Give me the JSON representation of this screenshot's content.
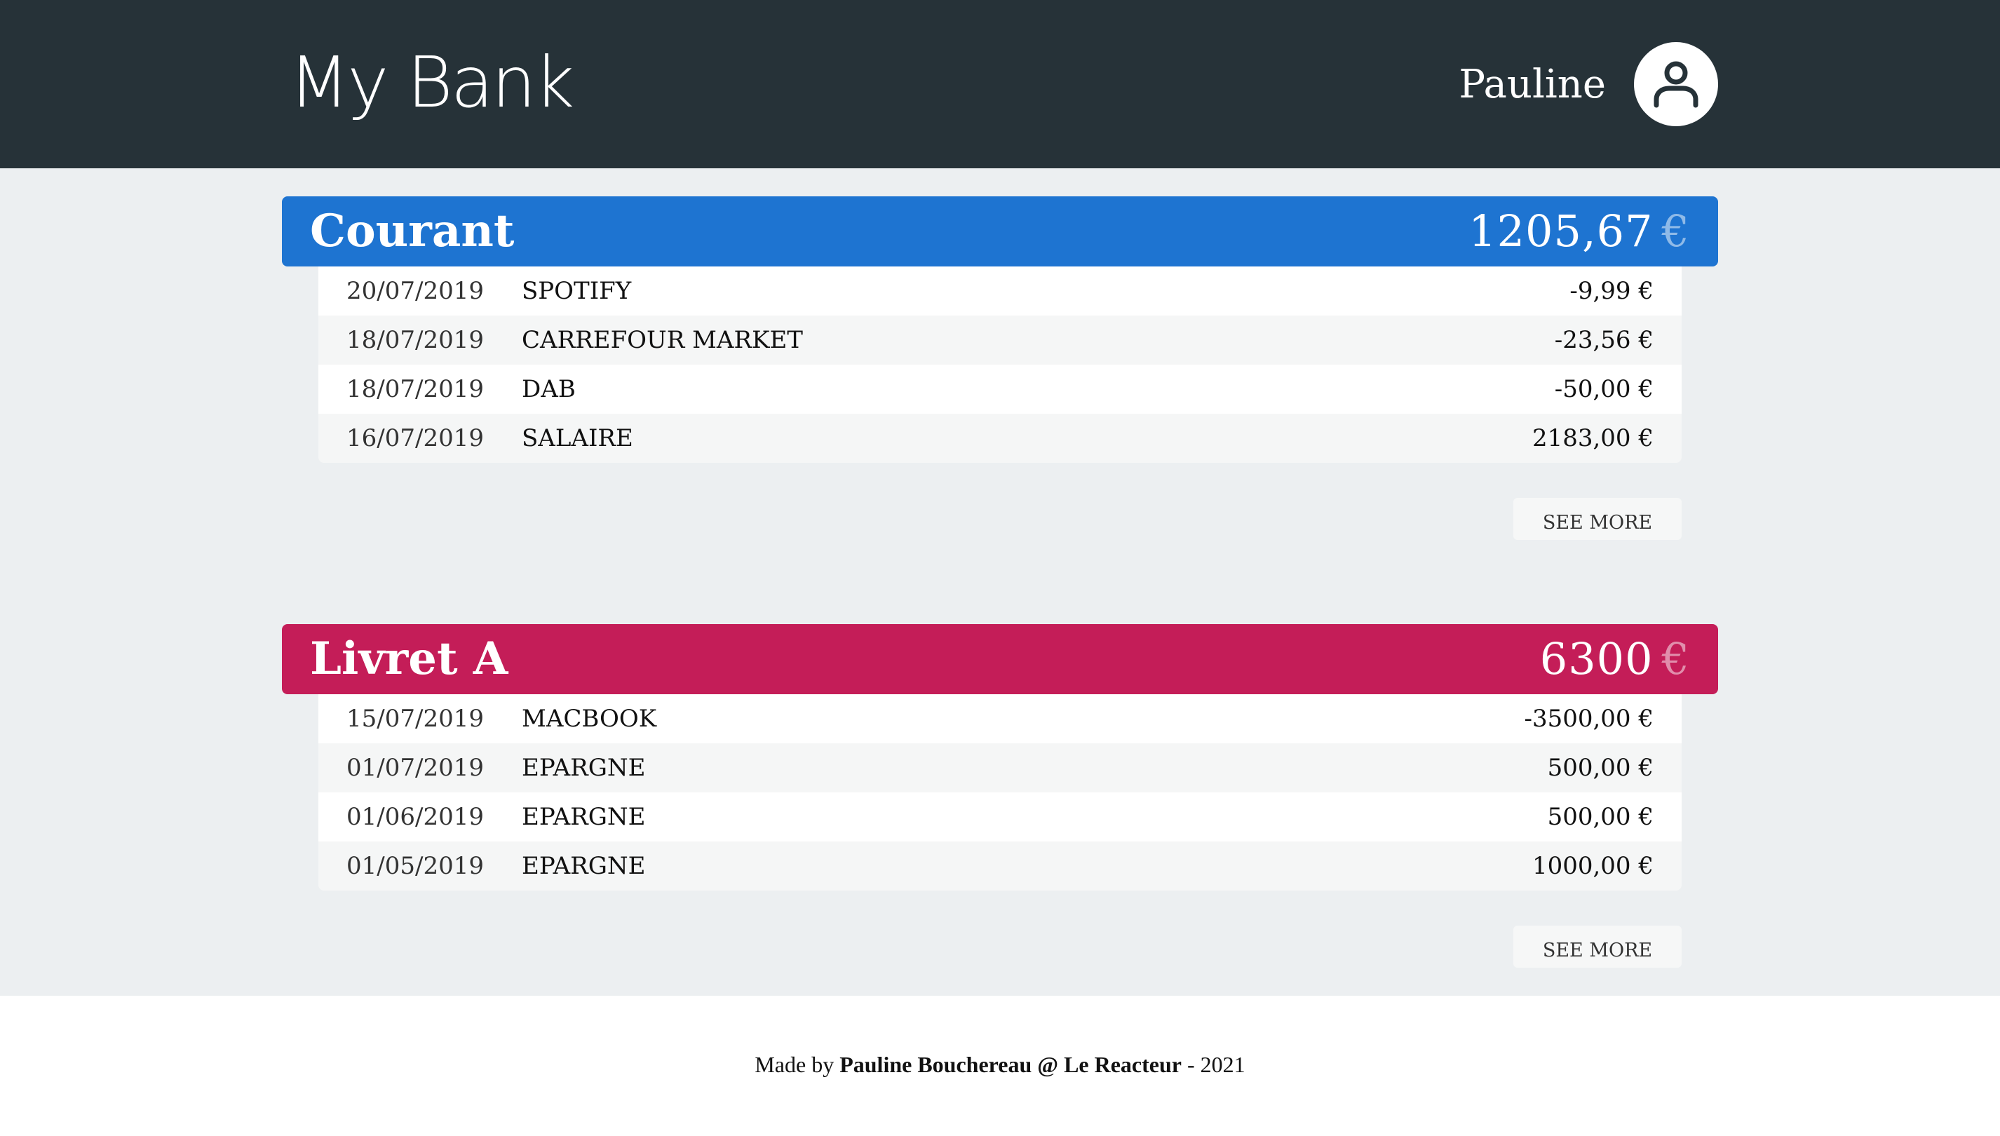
{
  "header": {
    "brand": "My Bank",
    "user_name": "Pauline",
    "avatar_icon": "user-icon"
  },
  "accounts": [
    {
      "name": "Courant",
      "balance": "1205,67",
      "currency": "€",
      "color": "#1e74d1",
      "transactions": [
        {
          "date": "20/07/2019",
          "label": "SPOTIFY",
          "amount": "-9,99 €"
        },
        {
          "date": "18/07/2019",
          "label": "CARREFOUR MARKET",
          "amount": "-23,56 €"
        },
        {
          "date": "18/07/2019",
          "label": "DAB",
          "amount": "-50,00 €"
        },
        {
          "date": "16/07/2019",
          "label": "SALAIRE",
          "amount": "2183,00 €"
        }
      ],
      "see_more": "SEE MORE"
    },
    {
      "name": "Livret A",
      "balance": "6300",
      "currency": "€",
      "color": "#c41d58",
      "transactions": [
        {
          "date": "15/07/2019",
          "label": "MACBOOK",
          "amount": "-3500,00 €"
        },
        {
          "date": "01/07/2019",
          "label": "EPARGNE",
          "amount": "500,00 €"
        },
        {
          "date": "01/06/2019",
          "label": "EPARGNE",
          "amount": "500,00 €"
        },
        {
          "date": "01/05/2019",
          "label": "EPARGNE",
          "amount": "1000,00 €"
        }
      ],
      "see_more": "SEE MORE"
    }
  ],
  "footer": {
    "prefix": "Made by",
    "author": "Pauline Bouchereau @ Le Reacteur",
    "suffix": "- 2021"
  }
}
